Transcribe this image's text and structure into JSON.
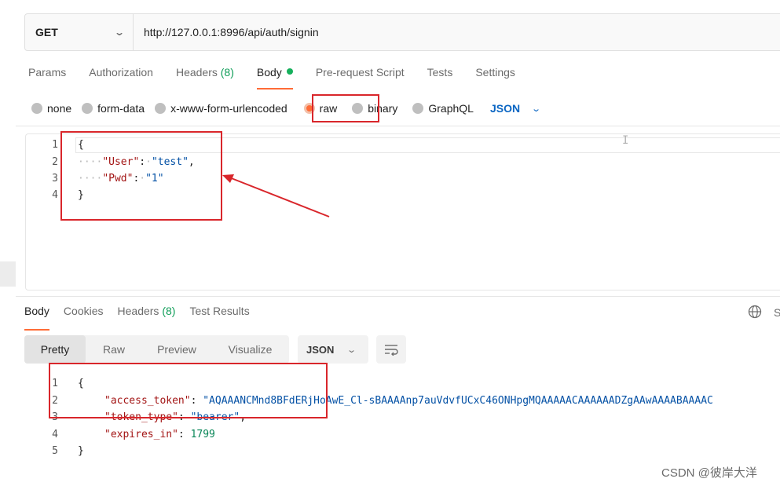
{
  "request": {
    "method": "GET",
    "url": "http://127.0.0.1:8996/api/auth/signin",
    "tabs": [
      {
        "label": "Params"
      },
      {
        "label": "Authorization"
      },
      {
        "label": "Headers",
        "count": "(8)"
      },
      {
        "label": "Body"
      },
      {
        "label": "Pre-request Script"
      },
      {
        "label": "Tests"
      },
      {
        "label": "Settings"
      }
    ],
    "body_types": [
      "none",
      "form-data",
      "x-www-form-urlencoded",
      "raw",
      "binary",
      "GraphQL"
    ],
    "body_format": "JSON",
    "line_numbers": [
      "1",
      "2",
      "3",
      "4"
    ],
    "code": {
      "open": "{",
      "indent": "····",
      "line2_key": "\"User\"",
      "line2_value": "\"test\"",
      "line3_key": "\"Pwd\"",
      "line3_value": "\"1\"",
      "close": "}"
    }
  },
  "response": {
    "tabs": [
      {
        "label": "Body"
      },
      {
        "label": "Cookies"
      },
      {
        "label": "Headers",
        "count": "(8)"
      },
      {
        "label": "Test Results"
      }
    ],
    "right_label": "S",
    "view_modes": [
      "Pretty",
      "Raw",
      "Preview",
      "Visualize"
    ],
    "format": "JSON",
    "line_numbers": [
      "1",
      "2",
      "3",
      "4",
      "5"
    ],
    "code": {
      "open": "{",
      "access_token_key": "\"access_token\"",
      "access_token_value": "\"AQAAANCMnd8BFdERjHoAwE_Cl-sBAAAAnp7auVdvfUCxC46ONHpgMQAAAAACAAAAAADZgAAwAAAABAAAAC",
      "token_type_key": "\"token_type\"",
      "token_type_value": "\"bearer\"",
      "expires_in_key": "\"expires_in\"",
      "expires_in_value": "1799",
      "close": "}"
    }
  },
  "watermark": "CSDN @彼岸大洋",
  "colors": {
    "accent": "#ff6c37",
    "annotation": "#d9262b",
    "json_blue": "#0b66c3",
    "count_green": "#0f9d58"
  },
  "icons": [
    "chevron-down-icon",
    "globe-icon",
    "wrap-lines-icon",
    "arrow-annotation"
  ]
}
